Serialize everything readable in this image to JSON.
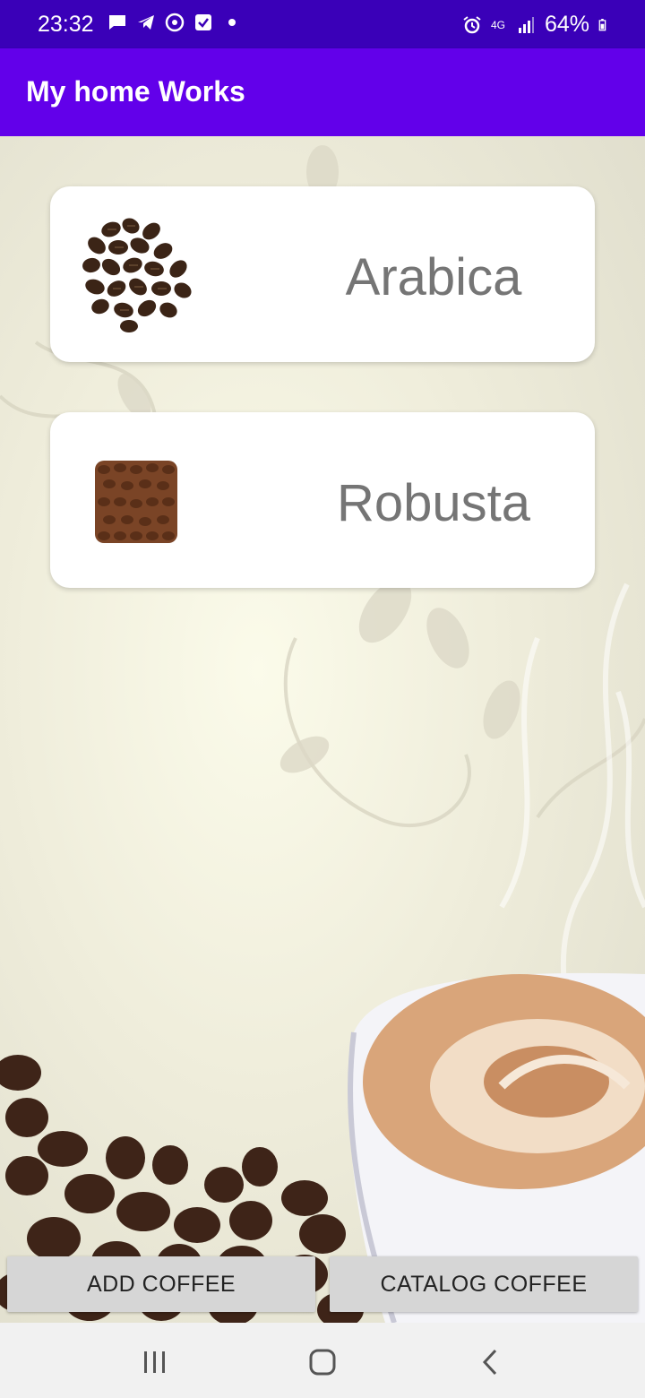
{
  "status_bar": {
    "time": "23:32",
    "battery": "64%",
    "network": "4G",
    "left_icons": [
      "message-icon",
      "telegram-icon",
      "sync-icon",
      "checkbox-icon",
      "dot-icon"
    ],
    "right_icons": [
      "alarm-icon",
      "network-icon",
      "signal-icon",
      "battery-icon"
    ]
  },
  "app_bar": {
    "title": "My home Works"
  },
  "cards": [
    {
      "label": "Arabica",
      "icon": "coffee-beans-pile-icon"
    },
    {
      "label": "Robusta",
      "icon": "coffee-beans-square-icon"
    }
  ],
  "buttons": {
    "add": "ADD COFFEE",
    "catalog": "CATALOG COFFEE"
  },
  "nav": [
    "recents-icon",
    "home-icon",
    "back-icon"
  ],
  "colors": {
    "status_bar": "#3a00b8",
    "app_bar": "#6200ea",
    "card_text": "#757575"
  }
}
